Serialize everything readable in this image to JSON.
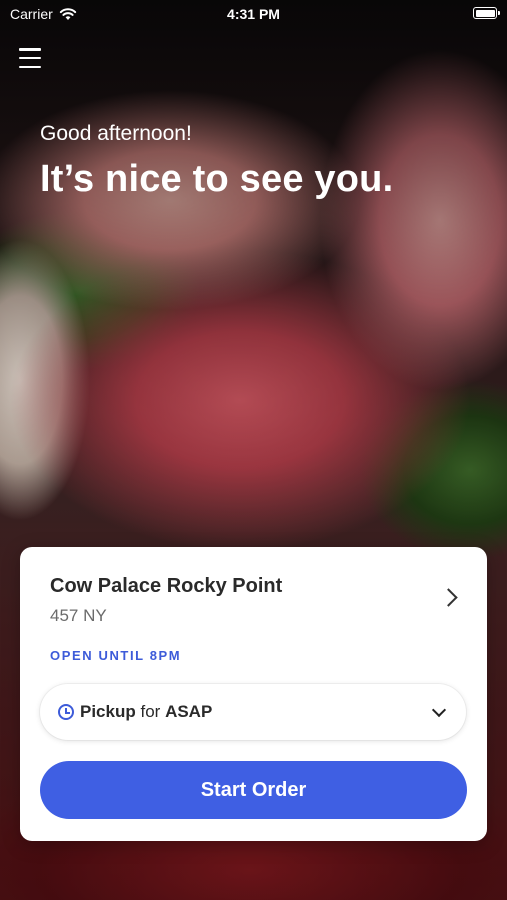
{
  "status_bar": {
    "carrier": "Carrier",
    "time": "4:31 PM"
  },
  "greeting": {
    "subtitle": "Good afternoon!",
    "title": "It’s nice to see you."
  },
  "store": {
    "name": "Cow Palace Rocky Point",
    "address": "457 NY",
    "status": "OPEN UNTIL 8PM"
  },
  "order": {
    "mode": "Pickup",
    "connector": "for",
    "time": "ASAP",
    "start_label": "Start Order"
  },
  "colors": {
    "accent": "#3F5FE3",
    "status_text": "#3D5BD9"
  }
}
